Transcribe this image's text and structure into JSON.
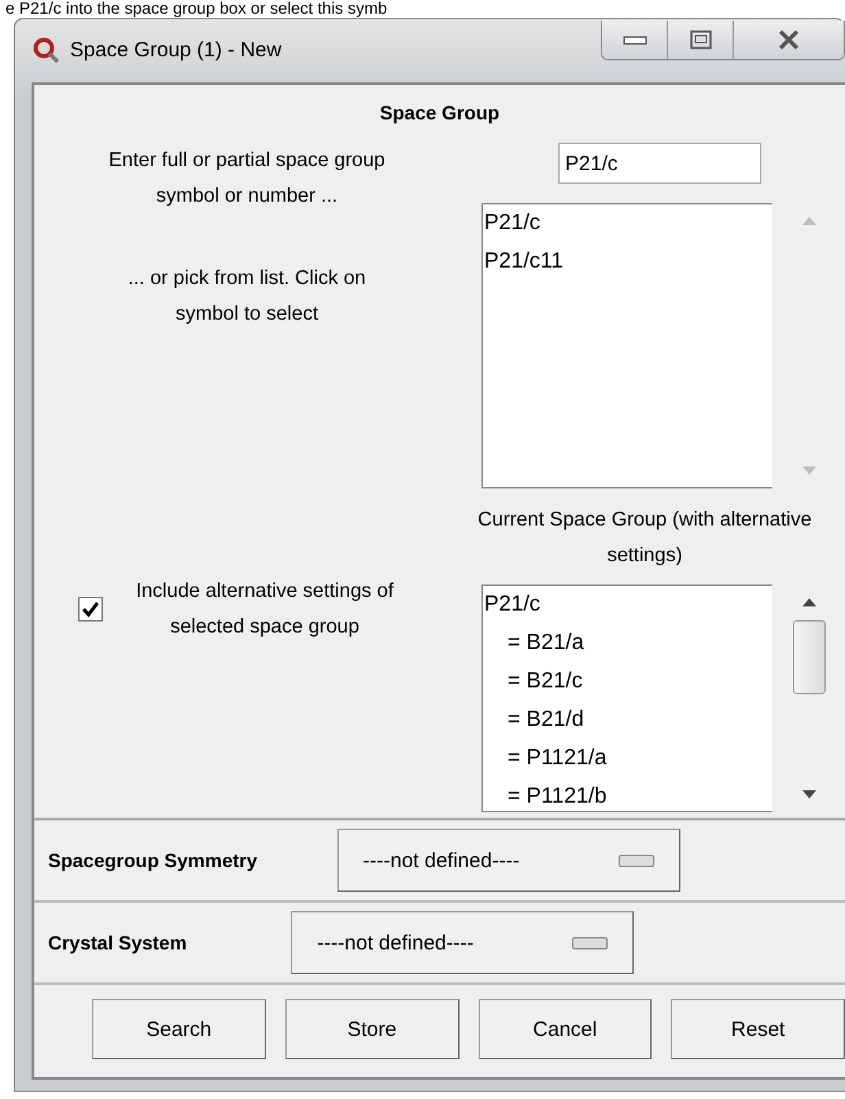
{
  "background_text": "e P21/c into the space group box or select this symb",
  "window": {
    "title": "Space Group (1) - New"
  },
  "heading": "Space Group",
  "entry": {
    "label": "Enter full or partial space group symbol or number ...",
    "value": "P21/c"
  },
  "pick_hint": "... or pick from list. Click on symbol to select",
  "match_list": [
    {
      "text": "P21/c",
      "selected": false
    },
    {
      "text": "P21/c11",
      "selected": false
    }
  ],
  "current_label": "Current Space Group (with alternative settings)",
  "include_alternatives": {
    "label": "Include alternative settings of selected space group",
    "checked": true
  },
  "current_list": [
    "P21/c",
    "= B21/a",
    "= B21/c",
    "= B21/d",
    "= P1121/a",
    "= P1121/b"
  ],
  "options": [
    {
      "label": "Spacegroup Symmetry",
      "value": "----not defined----"
    },
    {
      "label": "Crystal System",
      "value": "----not defined----"
    }
  ],
  "buttons": [
    "Search",
    "Store",
    "Cancel",
    "Reset"
  ]
}
